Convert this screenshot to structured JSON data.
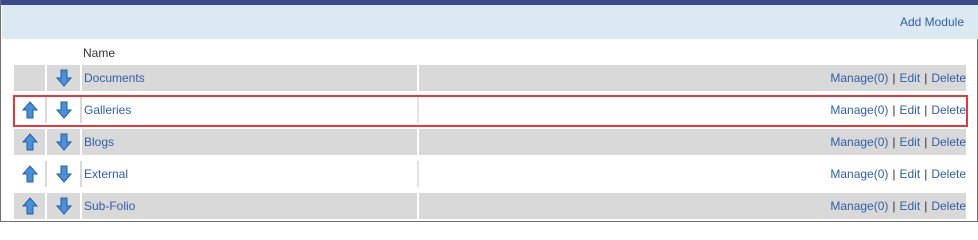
{
  "header": {
    "add_module_label": "Add Module",
    "column_name": "Name"
  },
  "actions": {
    "manage": "Manage(0)",
    "edit": "Edit",
    "delete": "Delete",
    "separator": "|"
  },
  "rows": [
    {
      "name": "Documents",
      "has_up": false,
      "has_down": true
    },
    {
      "name": "Galleries",
      "has_up": true,
      "has_down": true,
      "highlighted": true
    },
    {
      "name": "Blogs",
      "has_up": true,
      "has_down": true
    },
    {
      "name": "External",
      "has_up": true,
      "has_down": true
    },
    {
      "name": "Sub-Folio",
      "has_up": true,
      "has_down": true
    }
  ],
  "colors": {
    "accent_bar": "#3a4b8c",
    "header_band": "#dce9f2",
    "link": "#2f5fa8",
    "row_grey": "#d9d9d9",
    "highlight": "#e0393e",
    "arrow_fill": "#4a90d9"
  },
  "icons": {
    "move_up": "arrow-up-icon",
    "move_down": "arrow-down-icon"
  }
}
